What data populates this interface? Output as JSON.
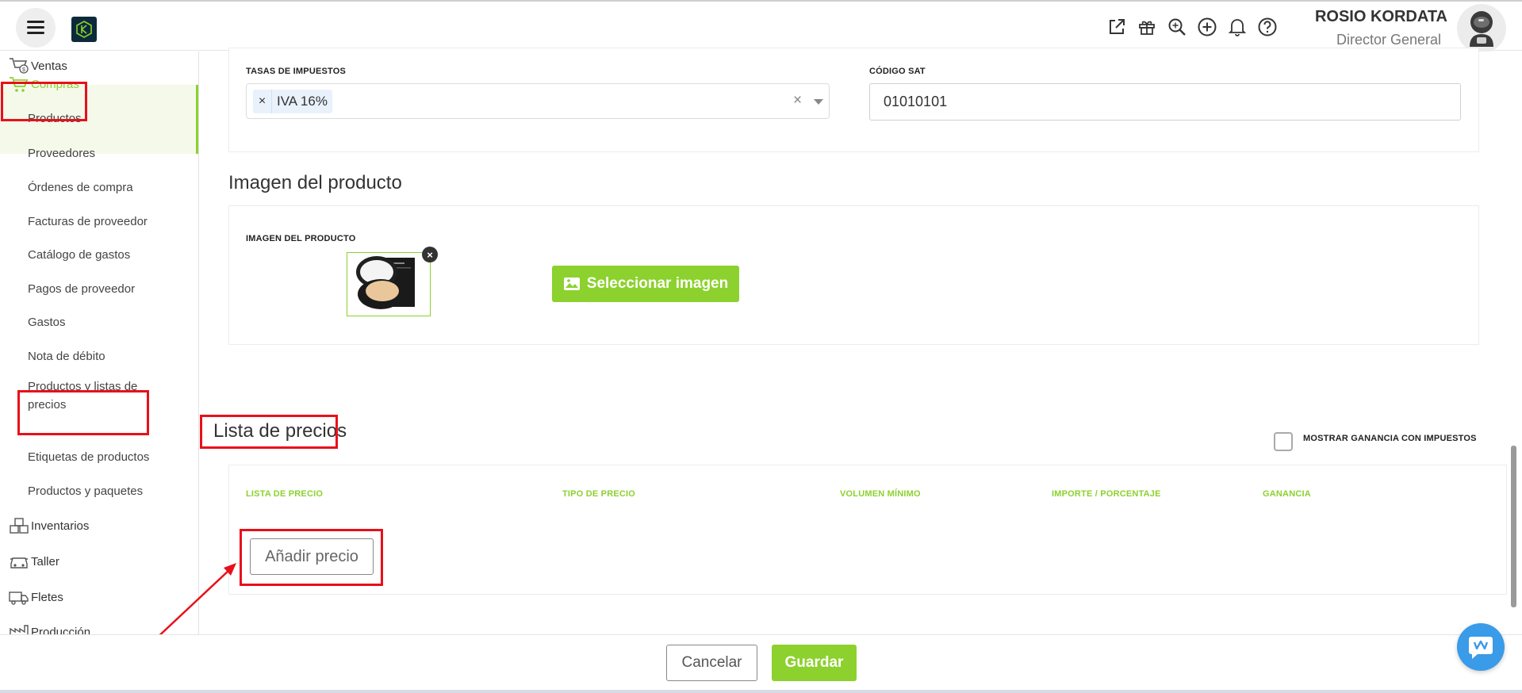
{
  "header": {
    "user_name": "ROSIO KORDATA",
    "user_role": "Director General",
    "icons": [
      "external-link-icon",
      "gift-icon",
      "search-icon",
      "plus-circle-icon",
      "bell-icon",
      "help-icon"
    ]
  },
  "sidebar": {
    "sections": {
      "ventas": "Ventas",
      "compras": "Compras",
      "inventarios": "Inventarios",
      "taller": "Taller",
      "fletes": "Fletes",
      "produccion": "Producción"
    },
    "compras_items": [
      "Productos",
      "Proveedores",
      "Órdenes de compra",
      "Facturas de proveedor",
      "Catálogo de gastos",
      "Pagos de proveedor",
      "Gastos",
      "Nota de débito",
      "Productos y listas de",
      "precios",
      "Etiquetas de productos",
      "Productos y paquetes"
    ]
  },
  "taxes": {
    "label": "TASAS DE IMPUESTOS",
    "tag_remove": "×",
    "tag_value": "IVA 16%",
    "clear": "×",
    "sat_label": "CÓDIGO SAT",
    "sat_value": "01010101"
  },
  "image_section": {
    "title": "Imagen del producto",
    "label": "IMAGEN DEL PRODUCTO",
    "remove": "×",
    "select_button": "Seleccionar imagen"
  },
  "price_list": {
    "title": "Lista de precios",
    "checkbox_label": "MOSTRAR GANANCIA CON IMPUESTOS",
    "columns": [
      "LISTA DE PRECIO",
      "TIPO DE PRECIO",
      "VOLUMEN MÍNIMO",
      "IMPORTE / PORCENTAJE",
      "GANANCIA"
    ],
    "add_button": "Añadir precio"
  },
  "footer": {
    "cancel": "Cancelar",
    "save": "Guardar"
  },
  "colors": {
    "accent": "#8cd12e",
    "highlight": "#e8101a",
    "chat": "#3a9be8"
  }
}
